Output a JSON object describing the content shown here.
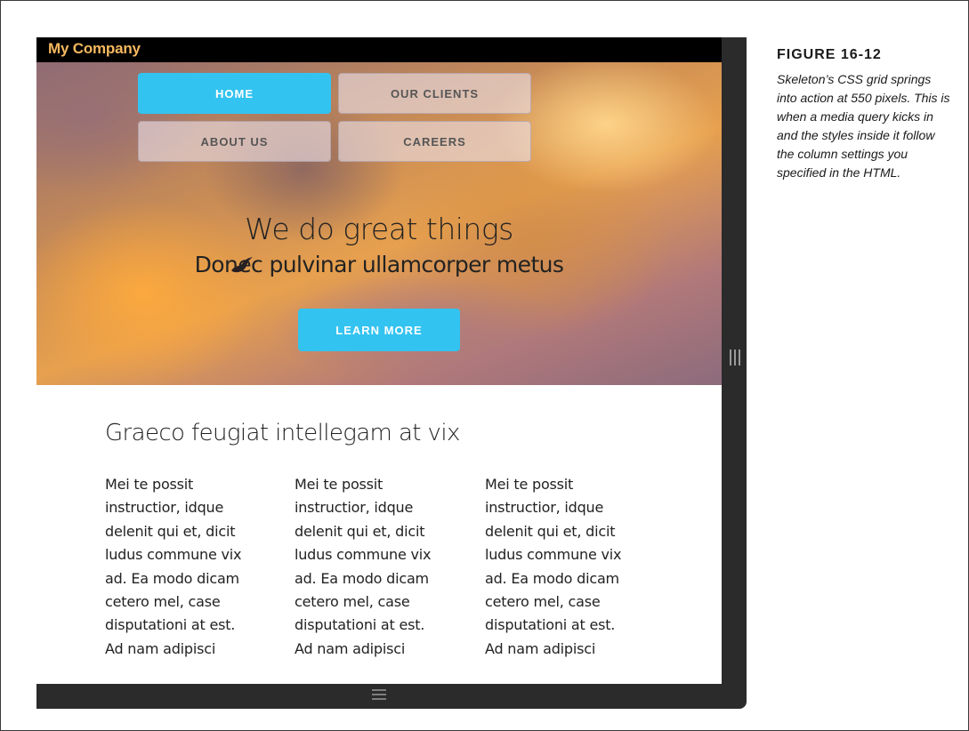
{
  "site": {
    "brand": "My Company",
    "nav": [
      {
        "label": "HOME",
        "active": true
      },
      {
        "label": "OUR CLIENTS",
        "active": false
      },
      {
        "label": "ABOUT US",
        "active": false
      },
      {
        "label": "CAREERS",
        "active": false
      }
    ],
    "hero": {
      "title": "We do great things",
      "subtitle": "Donec pulvinar ullamcorper metus",
      "cta_label": "LEARN MORE"
    },
    "content": {
      "title": "Graeco feugiat intellegam at vix",
      "columns": [
        [
          "Mei te possit",
          "instructior, idque",
          "delenit qui et, dicit",
          "ludus commune vix",
          "ad. Ea modo dicam",
          "cetero mel, case",
          "disputationi at est.",
          "Ad nam adipisci"
        ],
        [
          "Mei te possit",
          "instructior, idque",
          "delenit qui et, dicit",
          "ludus commune vix",
          "ad. Ea modo dicam",
          "cetero mel, case",
          "disputationi at est.",
          "Ad nam adipisci"
        ],
        [
          "Mei te possit",
          "instructior, idque",
          "delenit qui et, dicit",
          "ludus commune vix",
          "ad. Ea modo dicam",
          "cetero mel, case",
          "disputationi at est.",
          "Ad nam adipisci"
        ]
      ]
    }
  },
  "caption": {
    "label": "FIGURE 16-12",
    "text": "Skeleton’s CSS grid springs into action at 550 pixels. This is when a media query kicks in and the styles inside it follow the column settings you specified in the HTML."
  },
  "colors": {
    "accent": "#33c3f0",
    "brand": "#f5b85f",
    "browser_chrome": "#2b2b2b"
  },
  "icons": {
    "bird": "bird-icon",
    "vertical_resize": "vertical-resize-handle-icon",
    "horizontal_resize": "horizontal-resize-handle-icon"
  }
}
